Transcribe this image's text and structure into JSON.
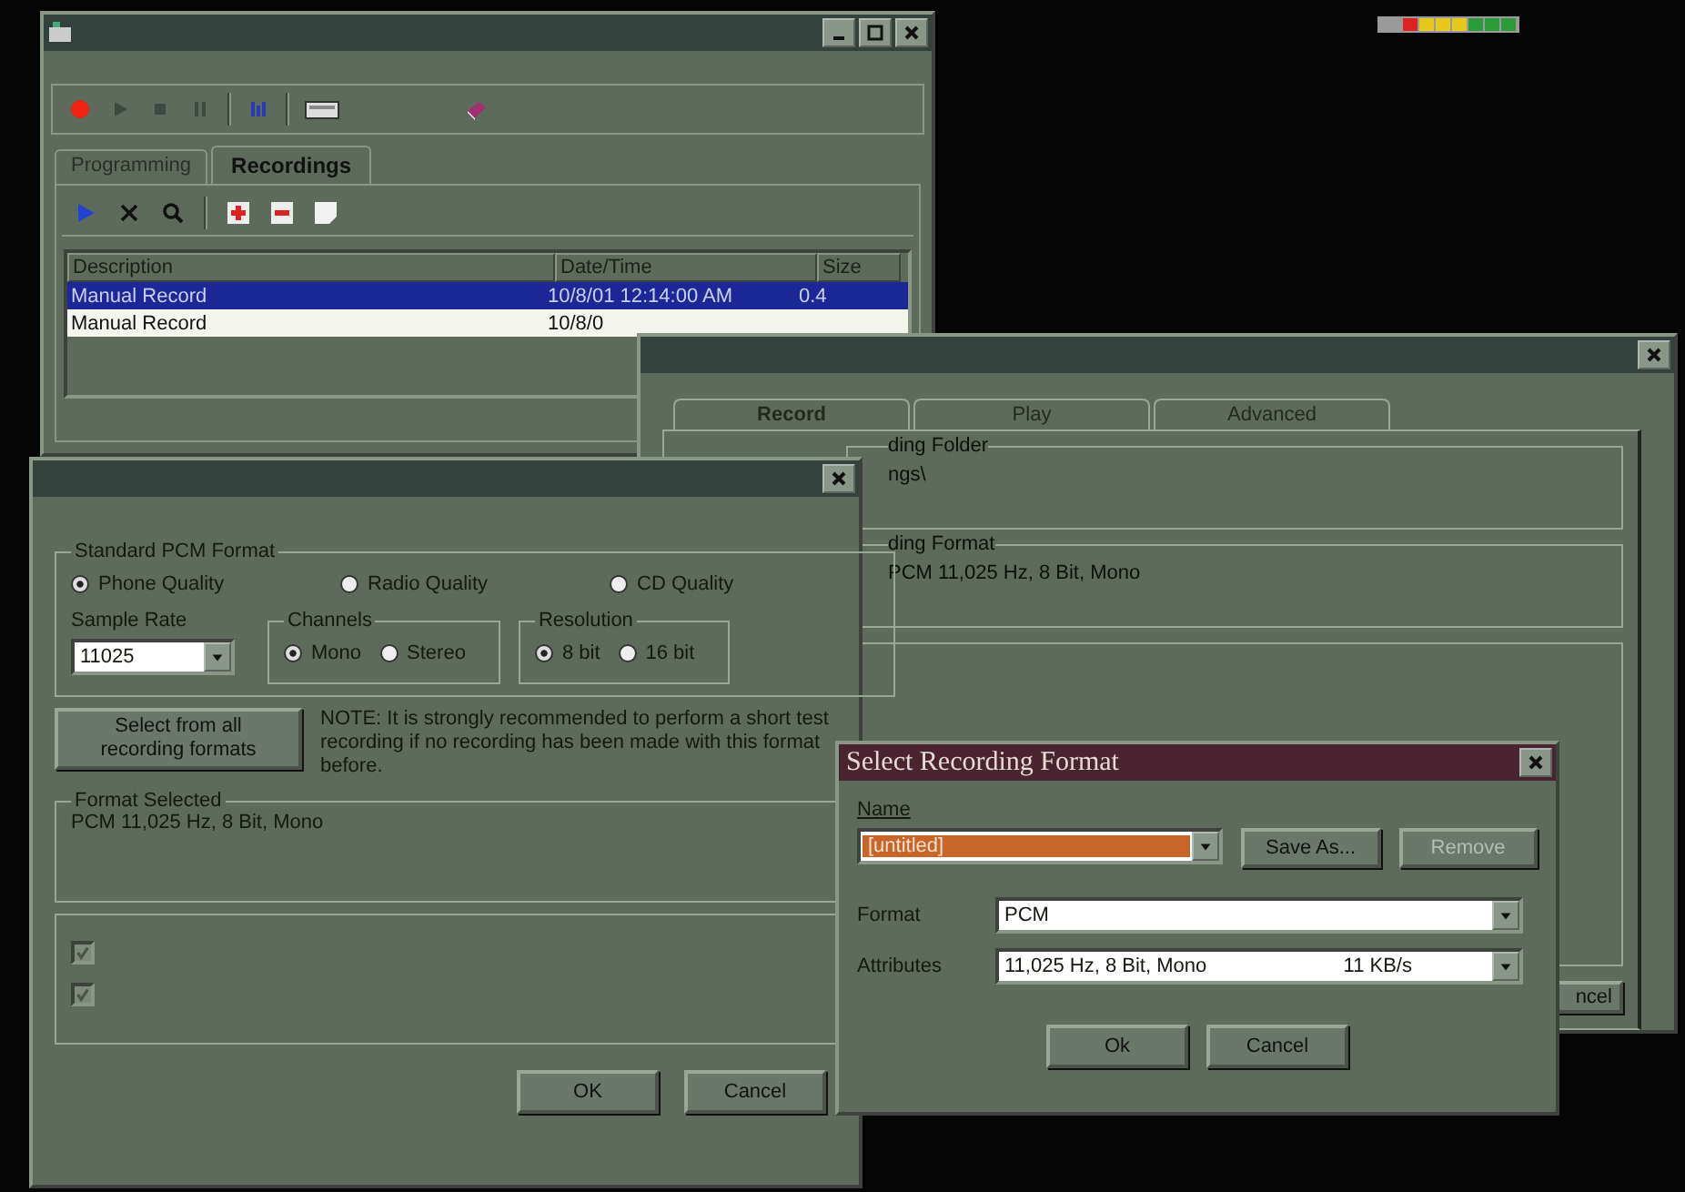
{
  "main_window": {
    "tabs": [
      {
        "label": "Programming",
        "selected": false
      },
      {
        "label": "Recordings",
        "selected": true
      }
    ],
    "list": {
      "columns": [
        "Description",
        "Date/Time",
        "Size"
      ],
      "rows": [
        {
          "cells": [
            "Manual Record",
            "10/8/01 12:14:00 AM",
            "0.4"
          ],
          "selected": true
        },
        {
          "cells": [
            "Manual Record",
            "10/8/0"
          ],
          "selected": false
        }
      ]
    }
  },
  "options_window": {
    "tabs": [
      {
        "label": "Record",
        "selected": true
      },
      {
        "label": "Play",
        "selected": false
      },
      {
        "label": "Advanced",
        "selected": false
      }
    ],
    "groups": [
      {
        "label": "ding Folder",
        "value": "ngs\\"
      },
      {
        "label": "ding Format",
        "value": "PCM 11,025 Hz, 8 Bit, Mono"
      }
    ],
    "button": "ncel"
  },
  "format_dialog": {
    "group_label": "Standard PCM Format",
    "qualities": [
      {
        "label": "Phone Quality",
        "selected": true
      },
      {
        "label": "Radio Quality",
        "selected": false
      },
      {
        "label": "CD Quality",
        "selected": false
      }
    ],
    "sample_rate": {
      "label": "Sample Rate",
      "value": "11025"
    },
    "channels": {
      "label": "Channels",
      "options": [
        {
          "label": "Mono",
          "selected": true
        },
        {
          "label": "Stereo",
          "selected": false
        }
      ]
    },
    "resolution": {
      "label": "Resolution",
      "options": [
        {
          "label": "8 bit",
          "selected": true
        },
        {
          "label": "16 bit",
          "selected": false
        }
      ]
    },
    "select_button": "Select from all recording formats",
    "note": "NOTE: It is strongly recommended to perform a short test recording if no recording has been made with this format before.",
    "format_selected": {
      "label": "Format Selected",
      "value": "PCM 11,025 Hz, 8 Bit, Mono"
    },
    "arp_checkboxes": [
      {
        "checked": true,
        "disabled": true
      },
      {
        "checked": true,
        "disabled": true
      }
    ],
    "buttons": [
      "OK",
      "Cancel"
    ]
  },
  "small_dialog": {
    "title": "Select Recording Format",
    "name": {
      "label": "Name",
      "value": "[untitled]"
    },
    "save_as": "Save As...",
    "remove": {
      "label": "Remove",
      "disabled": true
    },
    "format": {
      "label": "Format",
      "value": "PCM"
    },
    "attributes": {
      "label": "Attributes",
      "value": "11,025 Hz, 8 Bit, Mono",
      "rate": "11 KB/s"
    },
    "buttons": [
      "Ok",
      "Cancel"
    ]
  }
}
